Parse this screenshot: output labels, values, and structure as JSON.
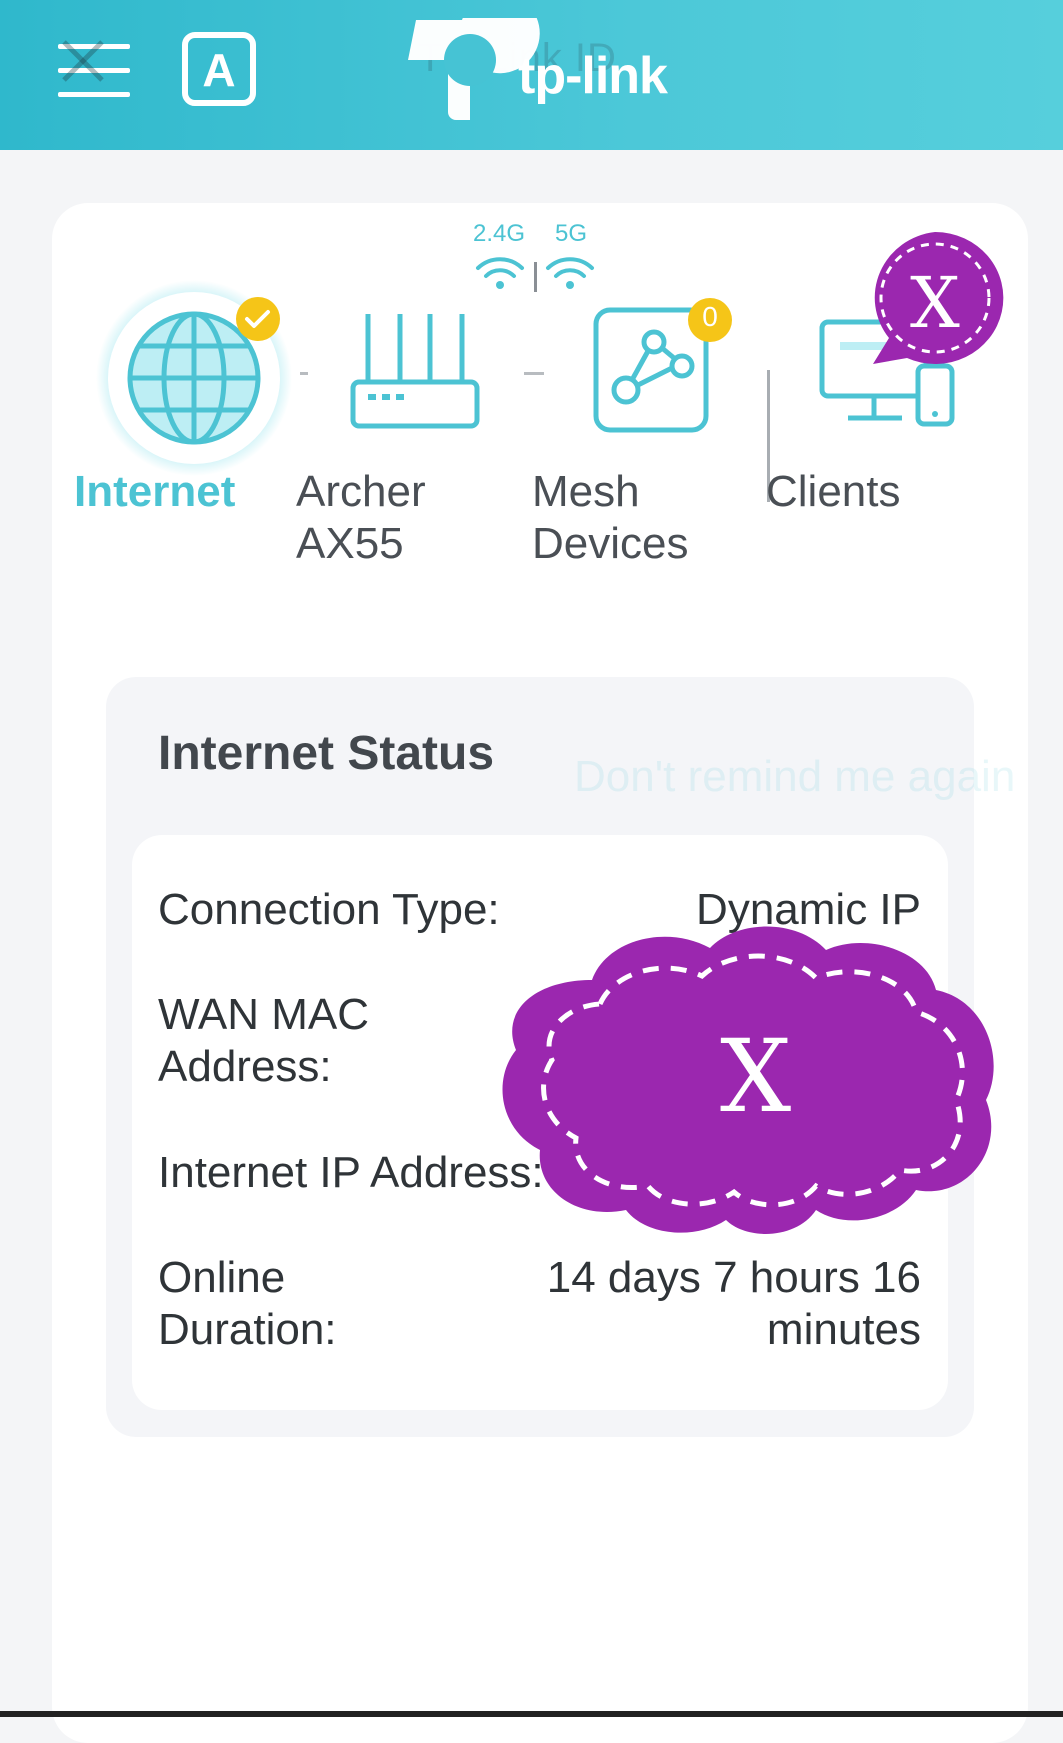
{
  "header": {
    "ghost_title": "TP-Link ID",
    "logo_text": "tp-link",
    "menu_icon": "hamburger-menu-icon",
    "account_icon": "letter-a-icon"
  },
  "bands": {
    "band_24": "2.4G",
    "band_5": "5G"
  },
  "topology": {
    "internet": {
      "label": "Internet",
      "status_badge": "check-icon"
    },
    "router": {
      "label_line1": "Archer",
      "label_line2": "AX55"
    },
    "mesh": {
      "label_line1": "Mesh",
      "label_line2": "Devices",
      "count": "0"
    },
    "clients": {
      "label": "Clients"
    }
  },
  "status": {
    "title": "Internet Status",
    "ghost_remind": "Don't remind me again",
    "rows": [
      {
        "label_line1": "Connection Type:",
        "value": "Dynamic IP"
      },
      {
        "label_line1": "WAN MAC",
        "label_line2": "Address:"
      },
      {
        "label_line1": "Internet IP Address:"
      },
      {
        "label_line1": "Online",
        "label_line2": "Duration:",
        "value_line1": "14 days 7 hours 16",
        "value_line2": "minutes"
      }
    ]
  },
  "stickers": {
    "small_mark": "X",
    "large_mark": "X"
  },
  "colors": {
    "accent": "#4cc3d3",
    "header": "#3fc0d2",
    "badge": "#f5c518",
    "sticker": "#9b27af"
  }
}
